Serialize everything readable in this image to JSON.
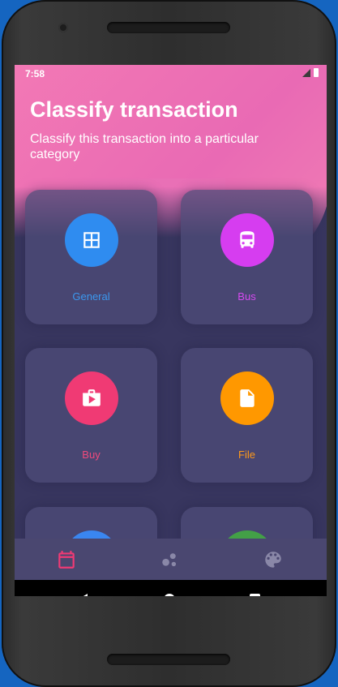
{
  "status": {
    "time": "7:58"
  },
  "header": {
    "title": "Classify transaction",
    "subtitle": "Classify this transaction into a particular category"
  },
  "categories": [
    {
      "label": "General",
      "icon": "grid-icon",
      "color": "#2f8cf0",
      "text_color": "#3b98ef"
    },
    {
      "label": "Bus",
      "icon": "bus-icon",
      "color": "#d63df0",
      "text_color": "#d54af0"
    },
    {
      "label": "Buy",
      "icon": "shop-icon",
      "color": "#f03a74",
      "text_color": "#f04a7c"
    },
    {
      "label": "File",
      "icon": "file-icon",
      "color": "#ff9800",
      "text_color": "#ff9a1a"
    },
    {
      "label": "",
      "icon": "unknown-icon",
      "color": "#3a86f0"
    },
    {
      "label": "",
      "icon": "unknown-icon",
      "color": "#43a047"
    }
  ],
  "bottom_nav": [
    {
      "icon": "calendar-icon",
      "active": true,
      "color": "#f03a74"
    },
    {
      "icon": "bubbles-icon",
      "active": false,
      "color": "#8a88a8"
    },
    {
      "icon": "palette-icon",
      "active": false,
      "color": "#8a88a8"
    }
  ]
}
